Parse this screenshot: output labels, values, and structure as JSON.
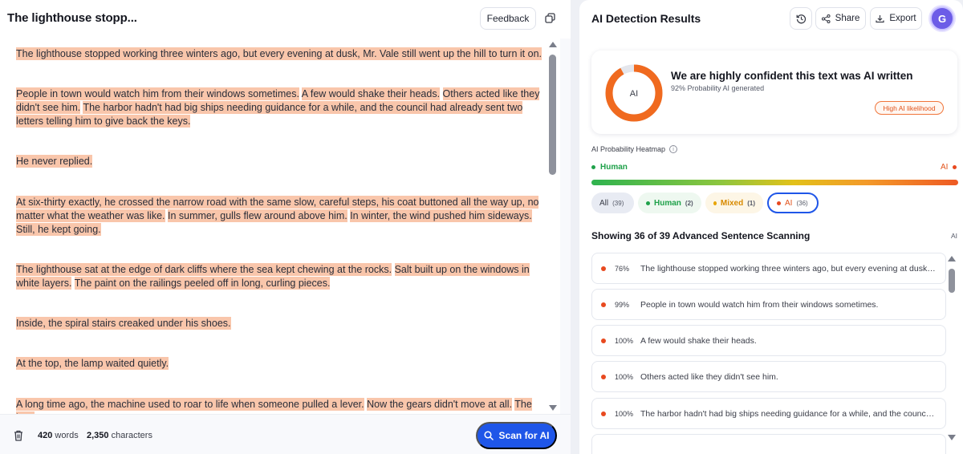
{
  "editor": {
    "title": "The lighthouse stopp...",
    "feedback_label": "Feedback",
    "paragraphs": {
      "p1": [
        "The lighthouse stopped working three winters ago, but every evening at dusk, Mr. Vale still went up the hill to turn it on."
      ],
      "p2": [
        "People in town would watch him from their windows sometimes.",
        "A few would shake their heads.",
        "Others acted like they didn't see him.",
        "The harbor hadn't had big ships needing guidance for a while, and the council had already sent two letters telling him to give back the keys."
      ],
      "p3": [
        "He never replied."
      ],
      "p4": [
        "At six-thirty exactly, he crossed the narrow road with the same slow, careful steps, his coat buttoned all the way up, no matter what the weather was like.",
        "In summer, gulls flew around above him.",
        "In winter, the wind pushed him sideways.",
        "Still, he kept going."
      ],
      "p5": [
        "The lighthouse sat at the edge of dark cliffs where the sea kept chewing at the rocks.",
        "Salt built up on the windows in white layers.",
        "The paint on the railings peeled off in long, curling pieces."
      ],
      "p6": [
        "Inside, the spiral stairs creaked under his shoes."
      ],
      "p7": [
        "At the top, the lamp waited quietly."
      ],
      "p8": [
        "A long time ago, the machine used to roar to life when someone pulled a lever.",
        "Now the gears didn't move at all.",
        "The lens"
      ]
    },
    "footer": {
      "words_count": "420",
      "words_label": "words",
      "chars_count": "2,350",
      "chars_label": "characters",
      "scan_label": "Scan for AI"
    }
  },
  "results": {
    "title": "AI Detection Results",
    "share_label": "Share",
    "export_label": "Export",
    "avatar_letter": "G",
    "summary": {
      "donut_label": "AI",
      "ai_probability": 92,
      "headline": "We are highly confident this text was AI written",
      "sub": "92% Probability AI generated",
      "badge": "High AI likelihood"
    },
    "heatmap": {
      "label": "AI Probability Heatmap",
      "info": "i",
      "left": "Human",
      "right": "AI"
    },
    "filters": [
      {
        "label": "All",
        "count": "(39)"
      },
      {
        "label": "Human",
        "count": "(2)"
      },
      {
        "label": "Mixed",
        "count": "(1)"
      },
      {
        "label": "AI",
        "count": "(36)"
      }
    ],
    "showing": "Showing 36 of 39 Advanced Sentence Scanning",
    "showing_tag": "AI",
    "sentences": [
      {
        "pct": "76%",
        "text": "The lighthouse stopped working three winters ago, but every evening at dusk, Mr. Vale still went up the hill to turn it on."
      },
      {
        "pct": "99%",
        "text": "People in town would watch him from their windows sometimes."
      },
      {
        "pct": "100%",
        "text": "A few would shake their heads."
      },
      {
        "pct": "100%",
        "text": "Others acted like they didn't see him."
      },
      {
        "pct": "100%",
        "text": "The harbor hadn't had big ships needing guidance for a while, and the council had already sent two letters telling him to give back the keys."
      },
      {
        "pct": "",
        "text": ""
      }
    ]
  },
  "colors": {
    "accent": "#1f56e8",
    "ai": "#e8491f",
    "human": "#1fa14a",
    "mixed": "#d88a00",
    "highlight": "#f9c6ab"
  }
}
